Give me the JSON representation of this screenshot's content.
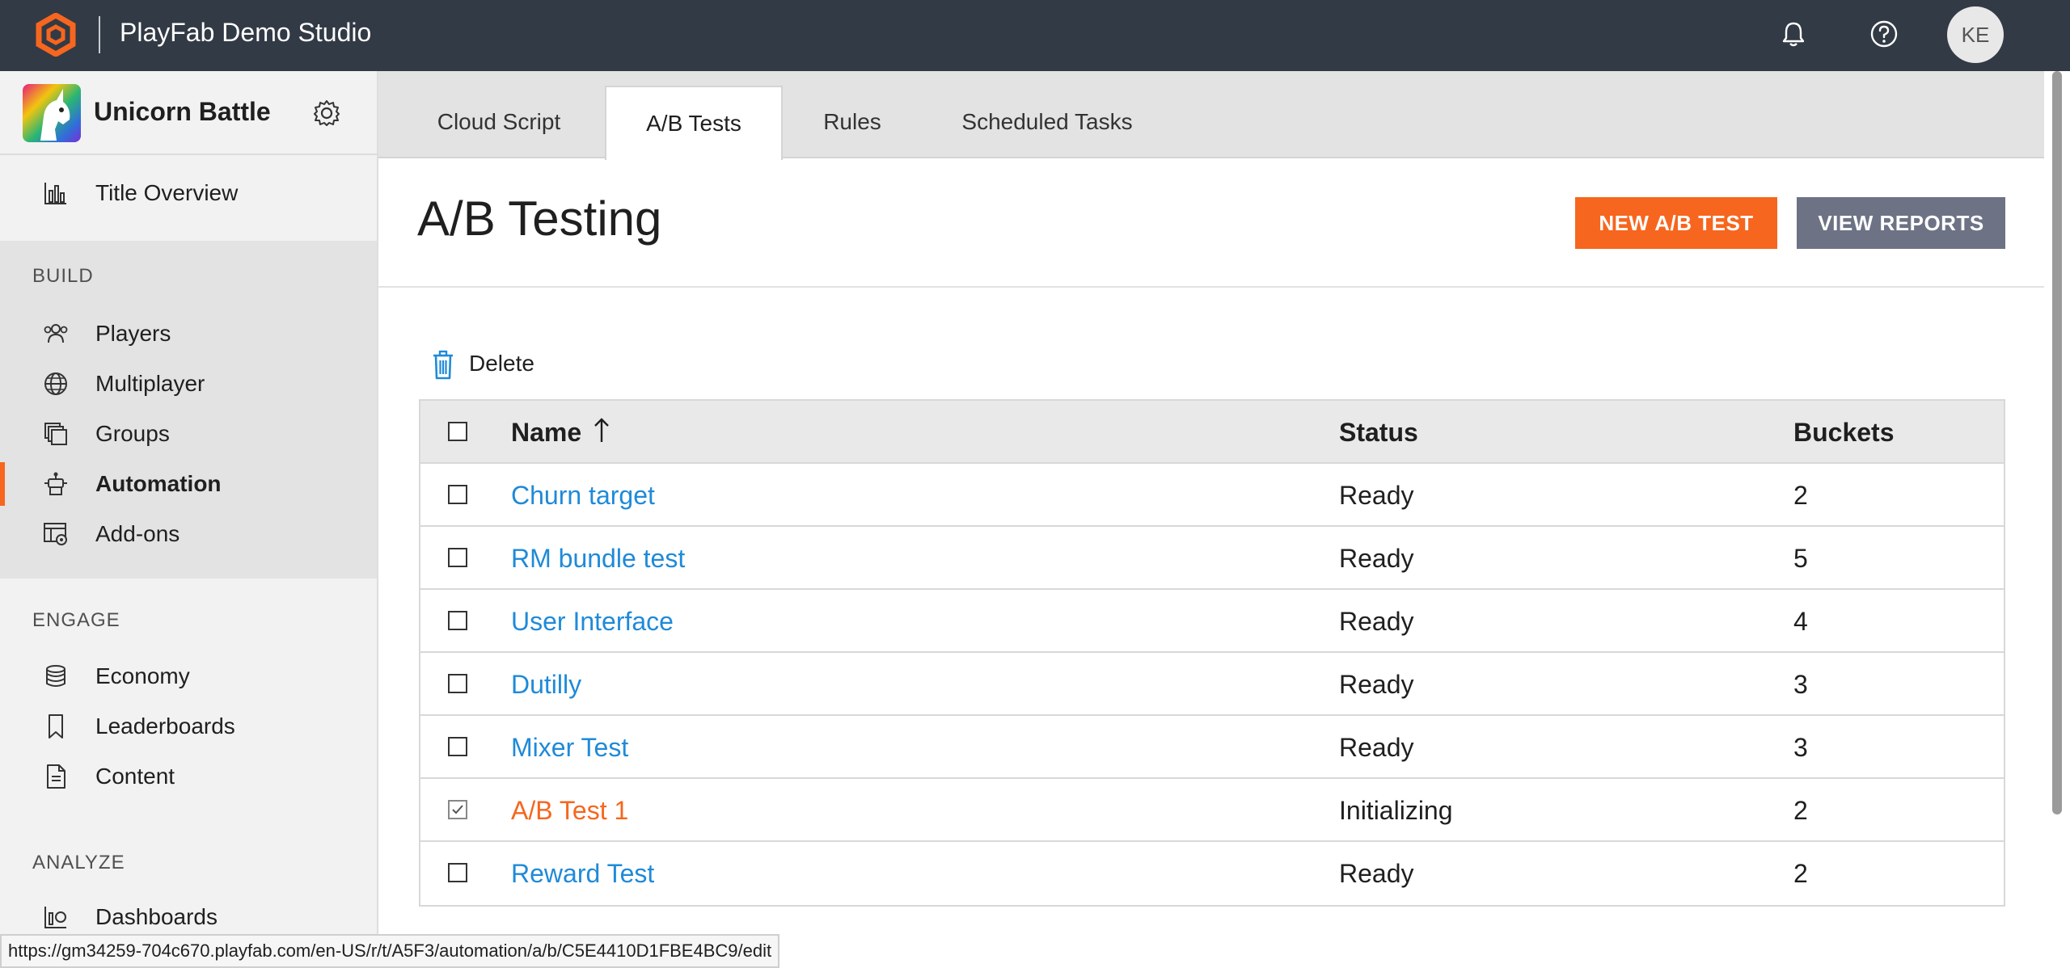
{
  "topbar": {
    "studio_name": "PlayFab Demo Studio",
    "avatar_initials": "KE",
    "brand_color": "#f6661e",
    "bg_color": "#323a45"
  },
  "title": {
    "name": "Unicorn Battle"
  },
  "sidebar": {
    "overview": "Title Overview",
    "sections": [
      {
        "heading": "BUILD",
        "items": [
          "Players",
          "Multiplayer",
          "Groups",
          "Automation",
          "Add-ons"
        ]
      },
      {
        "heading": "ENGAGE",
        "items": [
          "Economy",
          "Leaderboards",
          "Content"
        ]
      },
      {
        "heading": "ANALYZE",
        "items": [
          "Dashboards"
        ]
      }
    ],
    "active_item": "Automation"
  },
  "tabs": [
    "Cloud Script",
    "A/B Tests",
    "Rules",
    "Scheduled Tasks"
  ],
  "active_tab": "A/B Tests",
  "page": {
    "title": "A/B Testing",
    "new_button": "NEW A/B TEST",
    "reports_button": "VIEW REPORTS",
    "delete_label": "Delete"
  },
  "table": {
    "columns": [
      "Name",
      "Status",
      "Buckets"
    ],
    "sort_indicator": "↑",
    "rows": [
      {
        "name": "Churn target",
        "status": "Ready",
        "buckets": "2",
        "checked": false
      },
      {
        "name": "RM bundle test",
        "status": "Ready",
        "buckets": "5",
        "checked": false
      },
      {
        "name": "User Interface",
        "status": "Ready",
        "buckets": "4",
        "checked": false
      },
      {
        "name": "Dutilly",
        "status": "Ready",
        "buckets": "3",
        "checked": false
      },
      {
        "name": "Mixer Test",
        "status": "Ready",
        "buckets": "3",
        "checked": false
      },
      {
        "name": "A/B Test 1",
        "status": "Initializing",
        "buckets": "2",
        "checked": true
      },
      {
        "name": "Reward Test",
        "status": "Ready",
        "buckets": "2",
        "checked": false
      }
    ]
  },
  "status_url": "https://gm34259-704c670.playfab.com/en-US/r/t/A5F3/automation/a/b/C5E4410D1FBE4BC9/edit"
}
